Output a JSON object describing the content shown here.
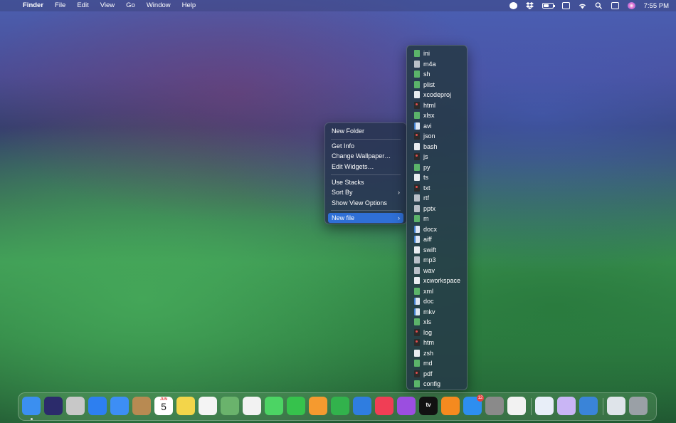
{
  "menubar": {
    "apple": "",
    "items": [
      "Finder",
      "File",
      "Edit",
      "View",
      "Go",
      "Window",
      "Help"
    ],
    "status_icons": [
      "privacy-icon",
      "dropbox-icon",
      "battery-icon",
      "clipboard-icon",
      "wifi-icon",
      "spotlight-search-icon",
      "control-center-icon",
      "siri-icon"
    ],
    "clock": "7:55 PM"
  },
  "context_menu": {
    "items": [
      {
        "label": "New Folder"
      },
      {
        "label": "Get Info"
      },
      {
        "label": "Change Wallpaper…"
      },
      {
        "label": "Edit Widgets…"
      },
      {
        "label": "Use Stacks"
      },
      {
        "label": "Sort By",
        "submenu": true
      },
      {
        "label": "Show View Options"
      },
      {
        "label": "New file",
        "submenu": true,
        "selected": true
      }
    ]
  },
  "submenu": {
    "items": [
      {
        "label": "ini",
        "icon": "green"
      },
      {
        "label": "m4a",
        "icon": "gray"
      },
      {
        "label": "sh",
        "icon": "green"
      },
      {
        "label": "plist",
        "icon": "green"
      },
      {
        "label": "xcodeproj",
        "icon": "white"
      },
      {
        "label": "html",
        "icon": "red"
      },
      {
        "label": "xlsx",
        "icon": "green"
      },
      {
        "label": "avi",
        "icon": "blue"
      },
      {
        "label": "json",
        "icon": "red"
      },
      {
        "label": "bash",
        "icon": "white"
      },
      {
        "label": "js",
        "icon": "red"
      },
      {
        "label": "py",
        "icon": "green"
      },
      {
        "label": "ts",
        "icon": "white"
      },
      {
        "label": "txt",
        "icon": "red"
      },
      {
        "label": "rtf",
        "icon": "gray"
      },
      {
        "label": "pptx",
        "icon": "gray"
      },
      {
        "label": "m",
        "icon": "green"
      },
      {
        "label": "docx",
        "icon": "blue"
      },
      {
        "label": "aiff",
        "icon": "blue"
      },
      {
        "label": "swift",
        "icon": "white"
      },
      {
        "label": "mp3",
        "icon": "gray"
      },
      {
        "label": "wav",
        "icon": "gray"
      },
      {
        "label": "xcworkspace",
        "icon": "white"
      },
      {
        "label": "xml",
        "icon": "green"
      },
      {
        "label": "doc",
        "icon": "blue"
      },
      {
        "label": "mkv",
        "icon": "blue"
      },
      {
        "label": "xls",
        "icon": "green"
      },
      {
        "label": "log",
        "icon": "red"
      },
      {
        "label": "htm",
        "icon": "red"
      },
      {
        "label": "zsh",
        "icon": "white"
      },
      {
        "label": "md",
        "icon": "green"
      },
      {
        "label": "pdf",
        "icon": "red"
      },
      {
        "label": "config",
        "icon": "green"
      }
    ]
  },
  "dock": {
    "apps": [
      {
        "name": "finder-icon",
        "color": "#3b8ff0",
        "running": true
      },
      {
        "name": "siri-app-icon",
        "color": "#2b2b6b"
      },
      {
        "name": "launchpad-icon",
        "color": "#c8c8c8"
      },
      {
        "name": "safari-icon",
        "color": "#2d7ff0"
      },
      {
        "name": "mail-icon",
        "color": "#3d8ef5"
      },
      {
        "name": "contacts-icon",
        "color": "#b88a52"
      },
      {
        "name": "calendar-icon",
        "color": "#ffffff",
        "month": "JUN",
        "day": "5"
      },
      {
        "name": "notes-icon",
        "color": "#f3d54a"
      },
      {
        "name": "reminders-icon",
        "color": "#f4f4f4"
      },
      {
        "name": "maps-icon",
        "color": "#6ab36c"
      },
      {
        "name": "photos-icon",
        "color": "#f2f2f2"
      },
      {
        "name": "messages-icon",
        "color": "#4cd464"
      },
      {
        "name": "facetime-icon",
        "color": "#36c24c"
      },
      {
        "name": "pages-icon",
        "color": "#f59a2f"
      },
      {
        "name": "numbers-icon",
        "color": "#32b24c"
      },
      {
        "name": "keynote-icon",
        "color": "#2f7de0"
      },
      {
        "name": "music-icon",
        "color": "#f03e55"
      },
      {
        "name": "podcasts-icon",
        "color": "#9b4ee0"
      },
      {
        "name": "apple-tv-icon",
        "color": "#111111",
        "label": "tv"
      },
      {
        "name": "books-icon",
        "color": "#f58a1f"
      },
      {
        "name": "app-store-icon",
        "color": "#2d8ef0",
        "badge": "12"
      },
      {
        "name": "system-settings-icon",
        "color": "#8a8a8a"
      },
      {
        "name": "chrome-icon",
        "color": "#f2f2f2"
      },
      {
        "name": "teams-icon",
        "color": "#e8eef8"
      },
      {
        "name": "cat-app-icon",
        "color": "#c9b5f5"
      },
      {
        "name": "xcode-icon",
        "color": "#3a84d8"
      },
      {
        "name": "documents-folder-icon",
        "color": "#dfe4ea"
      },
      {
        "name": "trash-icon",
        "color": "#9aa0a6"
      }
    ]
  }
}
